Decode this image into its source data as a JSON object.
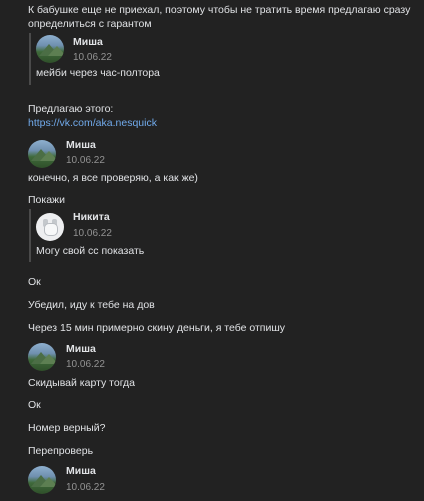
{
  "messages": {
    "m0_line1": "К бабушке еще не приехал, поэтому чтобы не тратить время предлагаю сразу",
    "m0_line2": "определиться с гарантом",
    "fwd1": {
      "author": "Миша",
      "date": "10.06.22",
      "text": "мейби через час-полтора"
    },
    "m1": "Предлагаю этого:",
    "m1_link": "https://vk.com/aka.nesquick",
    "fwd2": {
      "author": "Миша",
      "date": "10.06.22",
      "text": "конечно, я все проверяю, а как же)"
    },
    "m2": "Покажи",
    "fwd3": {
      "author": "Никита",
      "date": "10.06.22",
      "text": "Могу свой сс показать"
    },
    "m3": "Ок",
    "m4": "Убедил, иду к тебе на дов",
    "m5": "Через 15 мин примерно скину деньги, я тебе отпишу",
    "fwd4": {
      "author": "Миша",
      "date": "10.06.22",
      "text": "Скидывай карту тогда"
    },
    "m6": "Ок",
    "m7": "Номер верный?",
    "m8": "Перепроверь",
    "fwd5": {
      "author": "Миша",
      "date": "10.06.22"
    }
  },
  "icons": {
    "mountain_avatar": "mountain-landscape-avatar",
    "dog_avatar": "default-dog-avatar"
  },
  "colors": {
    "background": "#222222",
    "text": "#e1e3e6",
    "link": "#71aaeb",
    "date": "#939393"
  }
}
